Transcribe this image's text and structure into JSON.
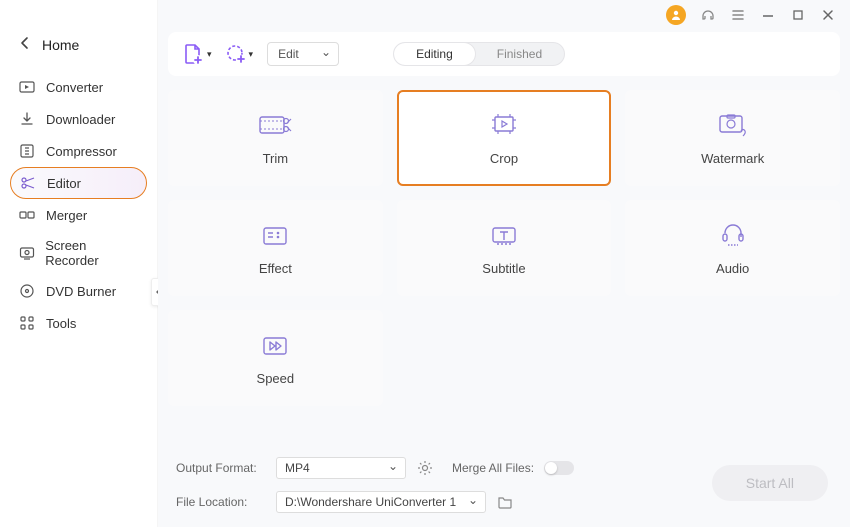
{
  "home": {
    "label": "Home"
  },
  "sidebar": {
    "items": [
      {
        "label": "Converter"
      },
      {
        "label": "Downloader"
      },
      {
        "label": "Compressor"
      },
      {
        "label": "Editor"
      },
      {
        "label": "Merger"
      },
      {
        "label": "Screen Recorder"
      },
      {
        "label": "DVD Burner"
      },
      {
        "label": "Tools"
      }
    ]
  },
  "toolbar": {
    "mode_select": "Edit",
    "tabs": {
      "editing": "Editing",
      "finished": "Finished"
    }
  },
  "cards": [
    {
      "label": "Trim"
    },
    {
      "label": "Crop"
    },
    {
      "label": "Watermark"
    },
    {
      "label": "Effect"
    },
    {
      "label": "Subtitle"
    },
    {
      "label": "Audio"
    },
    {
      "label": "Speed"
    }
  ],
  "footer": {
    "output_format_label": "Output Format:",
    "output_format_value": "MP4",
    "file_location_label": "File Location:",
    "file_location_value": "D:\\Wondershare UniConverter 1",
    "merge_label": "Merge All Files:",
    "start_label": "Start All"
  }
}
